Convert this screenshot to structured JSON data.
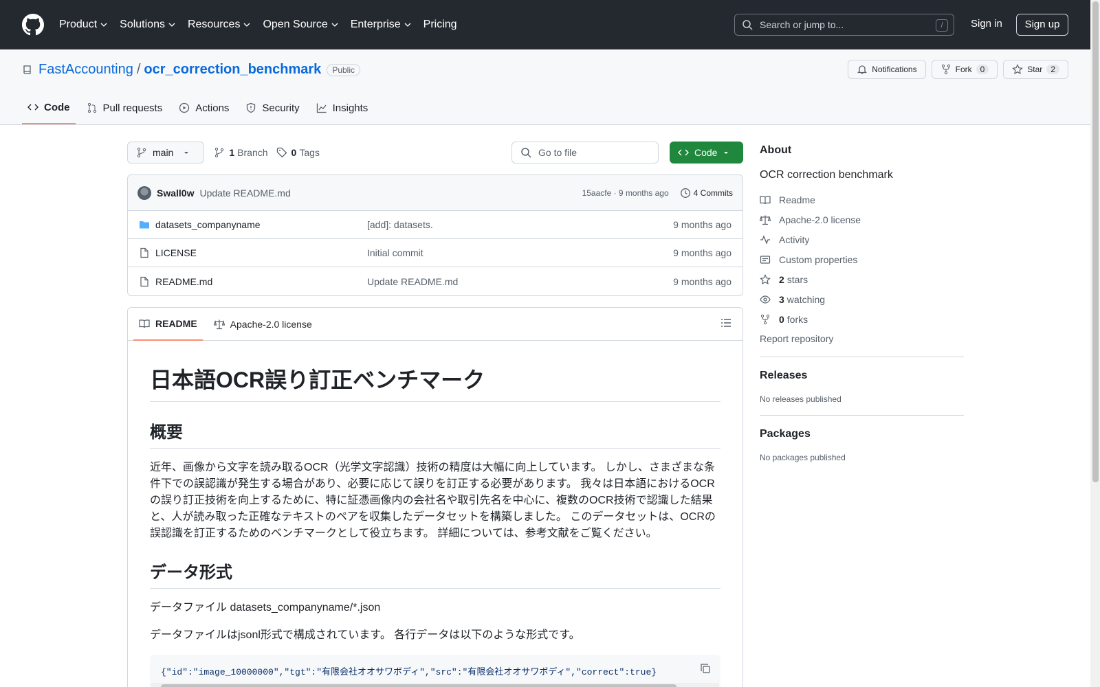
{
  "header": {
    "nav": [
      "Product",
      "Solutions",
      "Resources",
      "Open Source",
      "Enterprise",
      "Pricing"
    ],
    "search_placeholder": "Search or jump to...",
    "search_shortcut": "/",
    "signin": "Sign in",
    "signup": "Sign up"
  },
  "repo": {
    "owner": "FastAccounting",
    "separator": "/",
    "name": "ocr_correction_benchmark",
    "visibility": "Public",
    "notifications": "Notifications",
    "fork_label": "Fork",
    "fork_count": "0",
    "star_label": "Star",
    "star_count": "2",
    "tabs": [
      "Code",
      "Pull requests",
      "Actions",
      "Security",
      "Insights"
    ]
  },
  "toolbar": {
    "branch": "main",
    "branch_count": "1",
    "branch_label": "Branch",
    "tag_count": "0",
    "tag_label": "Tags",
    "goto_placeholder": "Go to file",
    "code_button": "Code"
  },
  "commit": {
    "author": "Swall0w",
    "message": "Update README.md",
    "meta": "15aacfe · 9 months ago",
    "commits": "4 Commits"
  },
  "files": [
    {
      "name": "datasets_companyname",
      "commit": "[add]: datasets.",
      "date": "9 months ago",
      "type": "folder"
    },
    {
      "name": "LICENSE",
      "commit": "Initial commit",
      "date": "9 months ago",
      "type": "file"
    },
    {
      "name": "README.md",
      "commit": "Update README.md",
      "date": "9 months ago",
      "type": "file"
    }
  ],
  "readme": {
    "tab_readme": "README",
    "tab_license": "Apache-2.0 license",
    "h1": "日本語OCR誤り訂正ベンチマーク",
    "h2_overview": "概要",
    "overview": "近年、画像から文字を読み取るOCR（光学文字認識）技術の精度は大幅に向上しています。 しかし、さまざまな条件下での誤認識が発生する場合があり、必要に応じて誤りを訂正する必要があります。 我々は日本語におけるOCRの誤り訂正技術を向上するために、特に証憑画像内の会社名や取引先名を中心に、複数のOCR技術で認識した結果と、人が読み取った正確なテキストのペアを収集したデータセットを構築しました。 このデータセットは、OCRの誤認識を訂正するためのベンチマークとして役立ちます。 詳細については、参考文献をご覧ください。",
    "h2_format": "データ形式",
    "datafile": "データファイル datasets_companyname/*.json",
    "format_desc": "データファイルはjsonl形式で構成されています。 各行データは以下のような形式です。",
    "code_line": "{\"id\":\"image_10000000\",\"tgt\":\"有限会社オオサワボディ\",\"src\":\"有限会社オオサワボディ\",\"correct\":true}"
  },
  "sidebar": {
    "about_title": "About",
    "description": "OCR correction benchmark",
    "readme": "Readme",
    "license": "Apache-2.0 license",
    "activity": "Activity",
    "custom": "Custom properties",
    "stars_count": "2",
    "stars_label": "stars",
    "watching_count": "3",
    "watching_label": "watching",
    "forks_count": "0",
    "forks_label": "forks",
    "report": "Report repository",
    "releases_title": "Releases",
    "releases_note": "No releases published",
    "packages_title": "Packages",
    "packages_note": "No packages published"
  }
}
